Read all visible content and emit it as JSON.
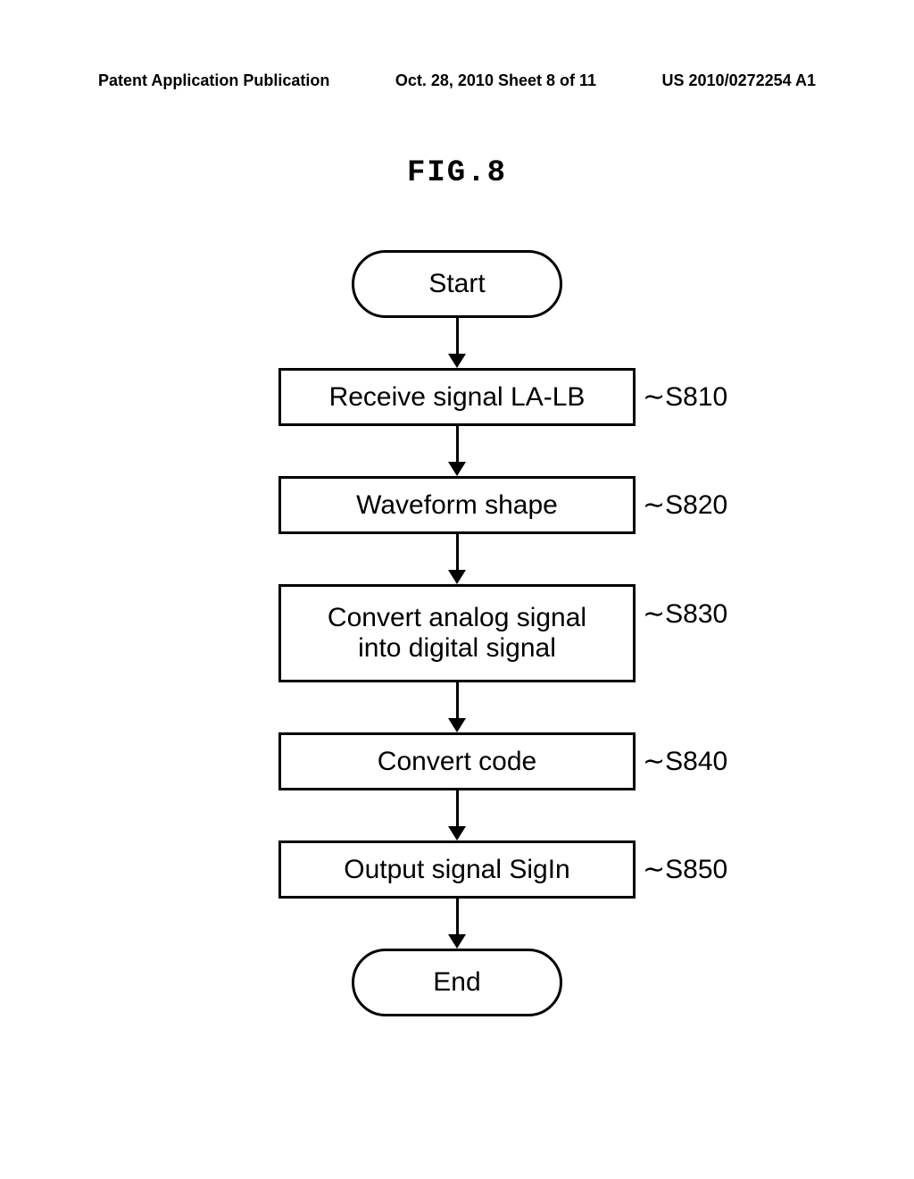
{
  "header": {
    "left": "Patent Application Publication",
    "mid": "Oct. 28, 2010  Sheet 8 of 11",
    "right": "US 2010/0272254 A1"
  },
  "figure_label": "FIG.8",
  "steps": {
    "start": "Start",
    "s810": "Receive signal LA-LB",
    "s810_ref": "S810",
    "s820": "Waveform shape",
    "s820_ref": "S820",
    "s830": "Convert analog signal\ninto digital signal",
    "s830_ref": "S830",
    "s840": "Convert code",
    "s840_ref": "S840",
    "s850": "Output signal SigIn",
    "s850_ref": "S850",
    "end": "End"
  }
}
